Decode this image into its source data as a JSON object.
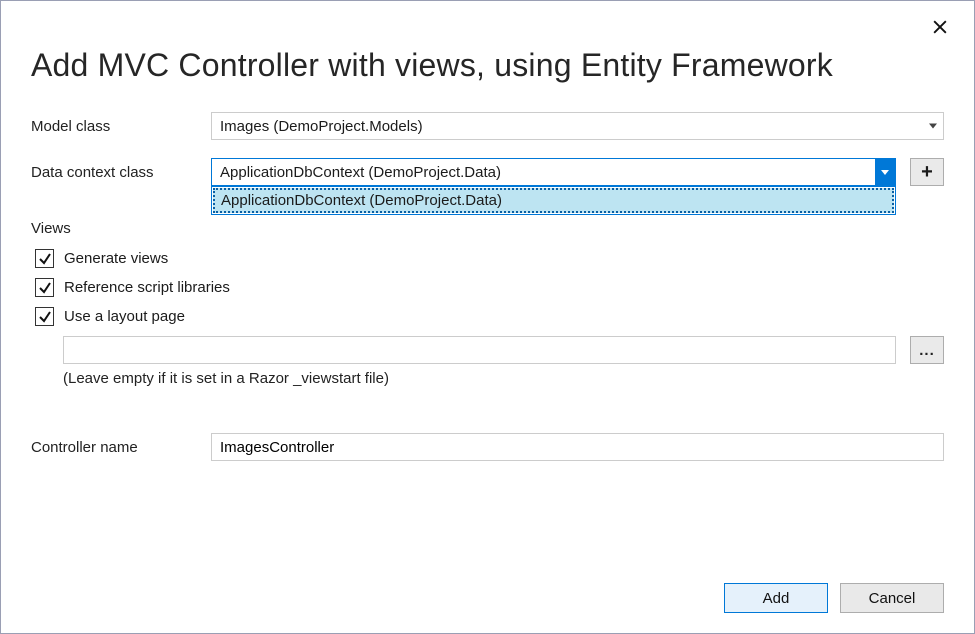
{
  "dialog": {
    "title": "Add MVC Controller with views, using Entity Framework"
  },
  "labels": {
    "model_class": "Model class",
    "data_context_class": "Data context class",
    "views": "Views",
    "controller_name": "Controller name"
  },
  "model_class": {
    "value": "Images (DemoProject.Models)"
  },
  "data_context": {
    "value": "ApplicationDbContext (DemoProject.Data)",
    "options": [
      "ApplicationDbContext (DemoProject.Data)"
    ]
  },
  "checks": {
    "generate_views": {
      "label": "Generate views",
      "checked": true
    },
    "reference_script_libs": {
      "label": "Reference script libraries",
      "checked": true
    },
    "use_layout_page": {
      "label": "Use a layout page",
      "checked": true
    }
  },
  "layout_page": {
    "value": "",
    "hint": "(Leave empty if it is set in a Razor _viewstart file)"
  },
  "controller_name": {
    "value": "ImagesController"
  },
  "buttons": {
    "add": "Add",
    "cancel": "Cancel",
    "plus": "+",
    "browse": "..."
  }
}
